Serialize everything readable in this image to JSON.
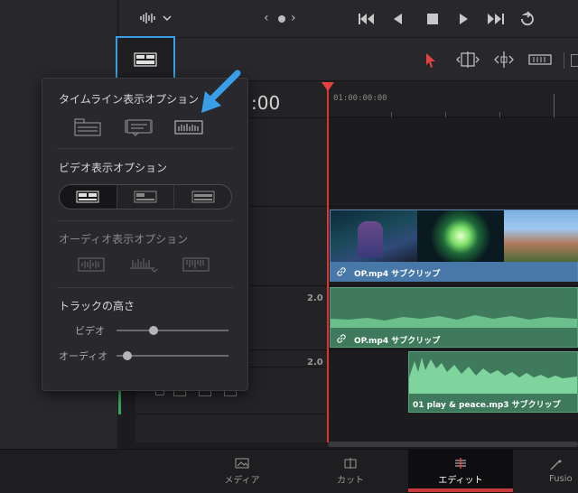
{
  "timecode_partial": ":00",
  "ruler": {
    "start": "01:00:00:00"
  },
  "popup": {
    "timeline_options_title": "タイムライン表示オプション",
    "video_options_title": "ビデオ表示オプション",
    "audio_options_title": "オーディオ表示オプション",
    "track_height_title": "トラックの高さ",
    "video_label": "ビデオ",
    "audio_label": "オーディオ",
    "video_height_level": 0.33,
    "audio_height_level": 0.1
  },
  "tracks": {
    "a1_level": "2.0",
    "a2_level": "2.0"
  },
  "clips": {
    "video_clip_label": "OP.mp4 サブクリップ",
    "audio1_clip_label": "OP.mp4 サブクリップ",
    "audio2_clip_label": "01 play & peace.mp3 サブクリップ"
  },
  "pages": {
    "media": "メディア",
    "cut": "カット",
    "edit": "エディット",
    "fusion": "Fusio"
  },
  "colors": {
    "accent": "#3a9ee6",
    "playhead": "#e64040",
    "video_clip": "#3b5e86",
    "audio_clip": "#3f7a5c",
    "edit_underline": "#c93a3a"
  }
}
